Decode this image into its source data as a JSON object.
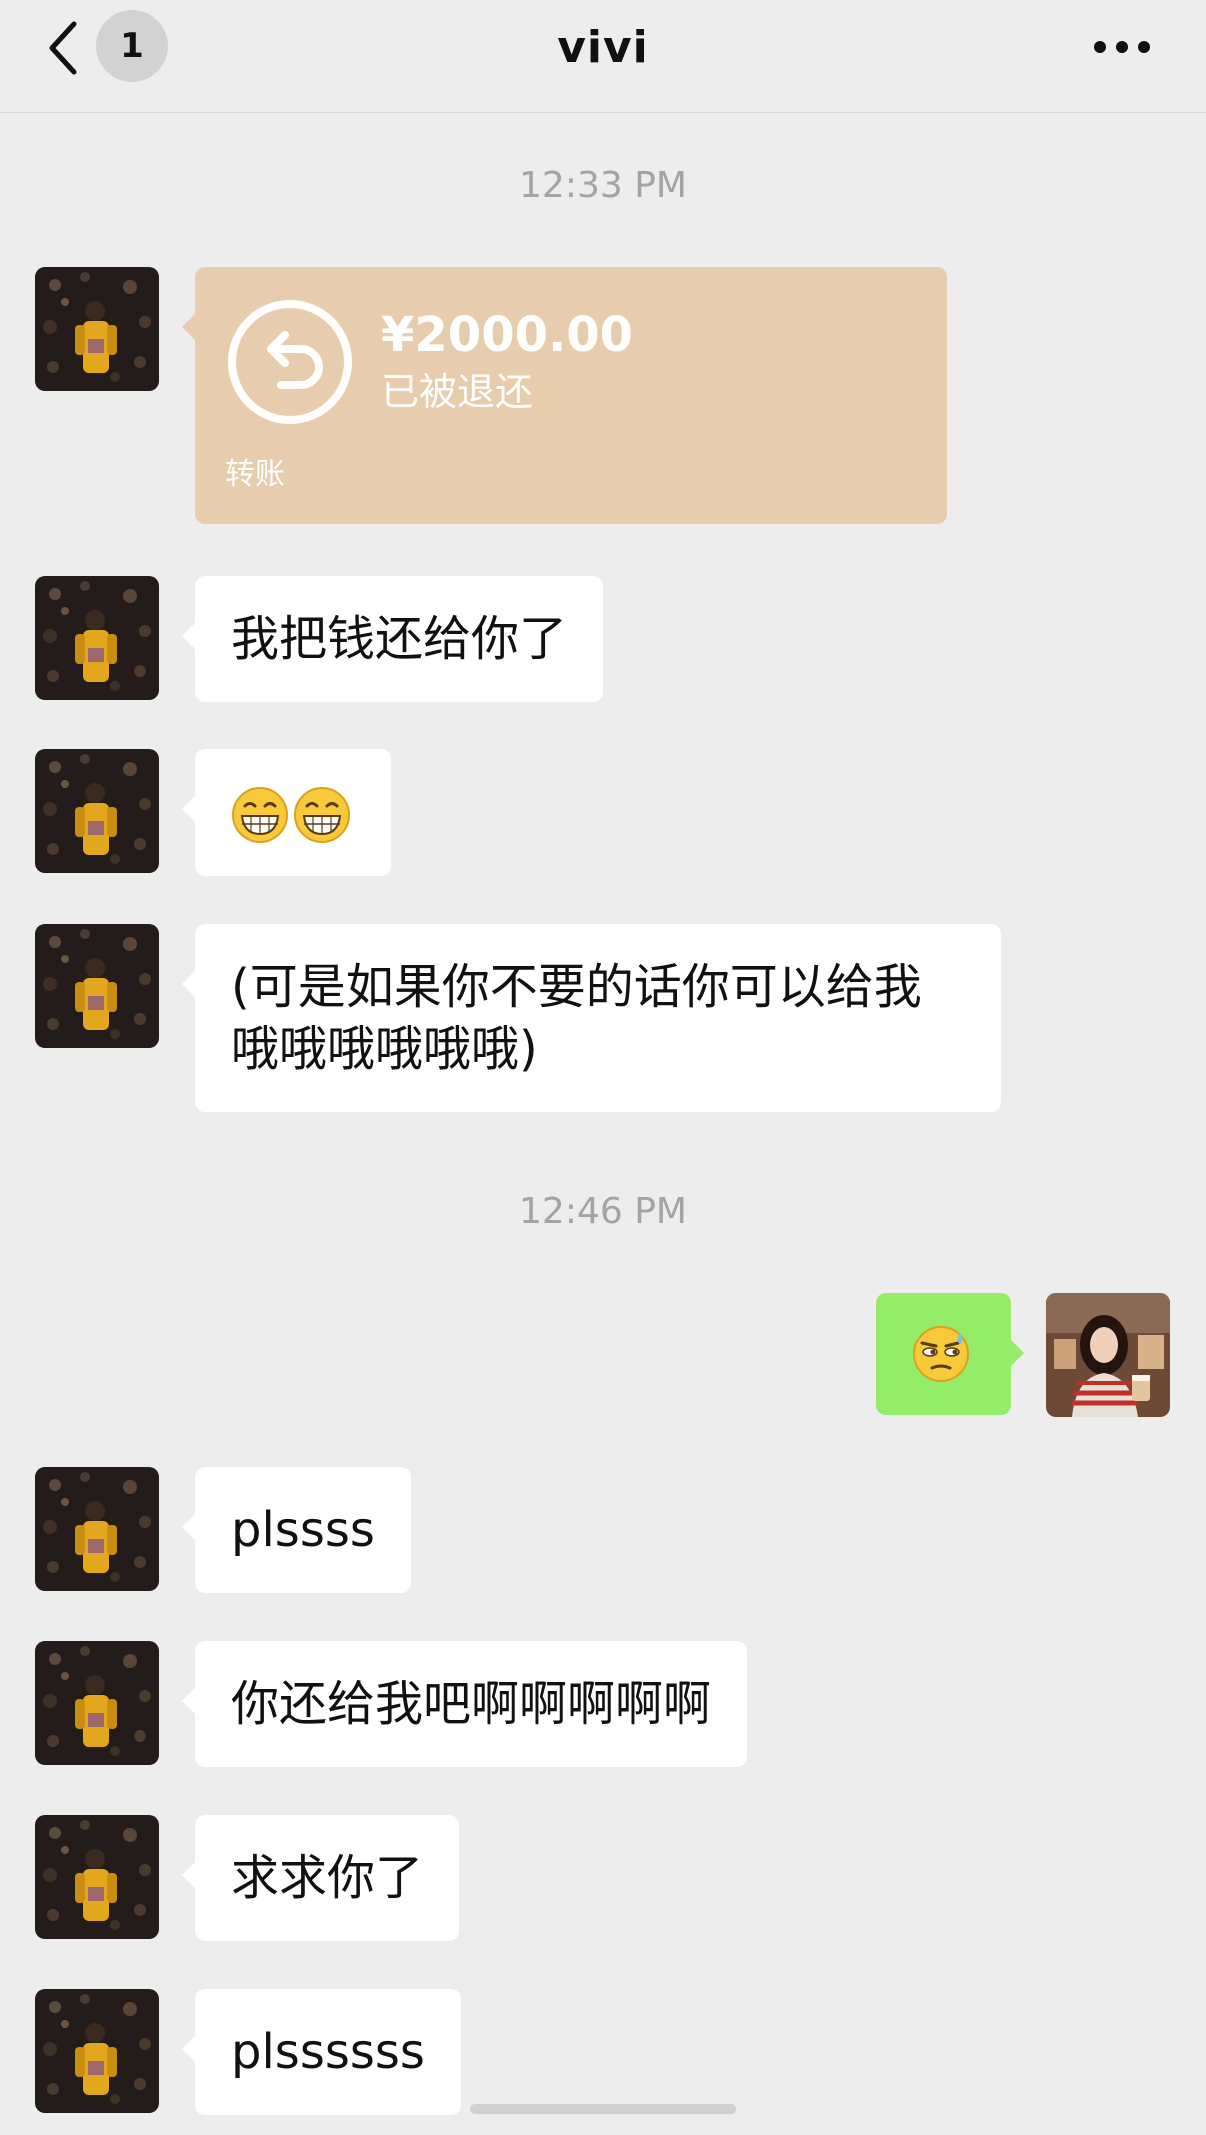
{
  "header": {
    "unread_count": "1",
    "title": "vivi"
  },
  "timestamps": [
    "12:33 PM",
    "12:46 PM"
  ],
  "transfer": {
    "amount": "¥2000.00",
    "status": "已被退还",
    "label": "转账"
  },
  "messages": [
    {
      "from": "them",
      "text": "我把钱还给你了"
    },
    {
      "from": "them",
      "emojis": [
        "grin-emoji",
        "grin-emoji"
      ]
    },
    {
      "from": "them",
      "text": "(可是如果你不要的话你可以给我哦哦哦哦哦哦)"
    },
    {
      "from": "me",
      "emojis": [
        "awkward-sweat-emoji"
      ]
    },
    {
      "from": "them",
      "text": "plssss"
    },
    {
      "from": "them",
      "text": "你还给我吧啊啊啊啊啊"
    },
    {
      "from": "them",
      "text": "求求你了"
    },
    {
      "from": "them",
      "text": "plssssss"
    }
  ],
  "colors": {
    "background": "#ededed",
    "bubble_in": "#ffffff",
    "bubble_out": "#95ec69",
    "transfer_card": "#e8ccae",
    "timestamp": "#a4a4a4"
  }
}
